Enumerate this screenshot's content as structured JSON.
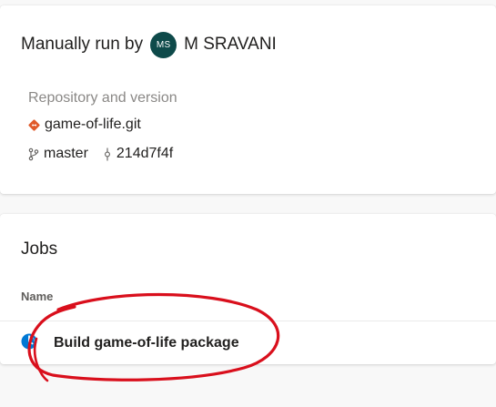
{
  "run": {
    "prefix": "Manually run by",
    "user_initials": "MS",
    "user_name": "M SRAVANI",
    "avatar_color": "#0e4a4a"
  },
  "repository": {
    "label": "Repository and version",
    "name": "game-of-life.git",
    "name_icon": "git-repo-icon",
    "branch": "master",
    "branch_icon": "branch-icon",
    "commit": "214d7f4f",
    "commit_icon": "commit-icon"
  },
  "jobs": {
    "title": "Jobs",
    "column_header": "Name",
    "items": [
      {
        "name": "Build game-of-life package",
        "status_icon": "running-status-icon",
        "status_color": "#0078d4"
      }
    ]
  },
  "annotation": {
    "color": "#d90f1c",
    "shape": "hand-drawn-circle"
  }
}
